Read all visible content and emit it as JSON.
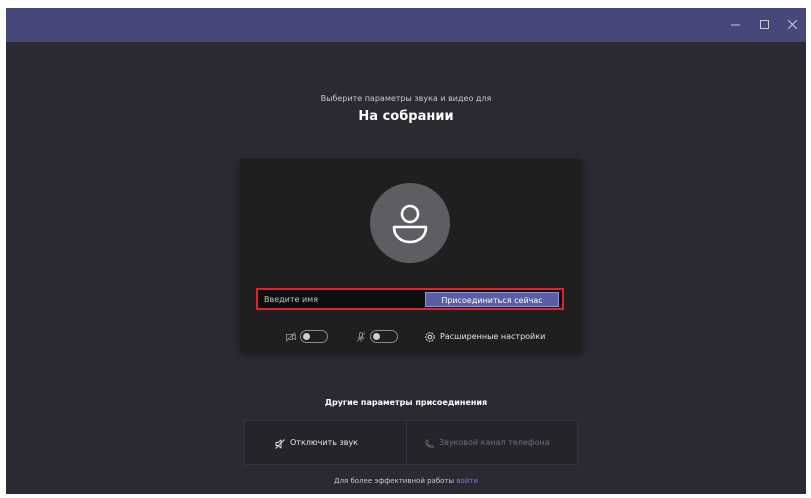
{
  "window": {
    "controls": {
      "minimize_icon": "minimize-icon",
      "maximize_icon": "maximize-icon",
      "close_icon": "close-icon"
    },
    "titlebar_color": "#454879",
    "background_color": "#2b2a33"
  },
  "header": {
    "subtitle": "Выберите параметры звука и видео для",
    "title": "На собрании"
  },
  "preview": {
    "avatar_icon": "person-icon",
    "name_placeholder": "Введите имя",
    "name_value": "",
    "join_button_label": "Присоединиться сейчас",
    "join_button_color": "#5a5ea6",
    "highlight_color": "#d9262c",
    "camera": {
      "icon": "camera-off-icon",
      "on": false
    },
    "microphone": {
      "icon": "mic-off-icon",
      "on": false
    },
    "settings": {
      "icon": "gear-icon",
      "label": "Расширенные настройки"
    }
  },
  "other_options": {
    "title": "Другие параметры присоединения",
    "mute_option": {
      "icon": "speaker-off-icon",
      "label": "Отключить звук",
      "enabled": true
    },
    "phone_option": {
      "icon": "phone-icon",
      "label": "Звуковой канал телефона",
      "enabled": false
    }
  },
  "footer": {
    "text": "Для более эффективной работы",
    "link_label": "войти",
    "link_color": "#7b7fd0"
  }
}
